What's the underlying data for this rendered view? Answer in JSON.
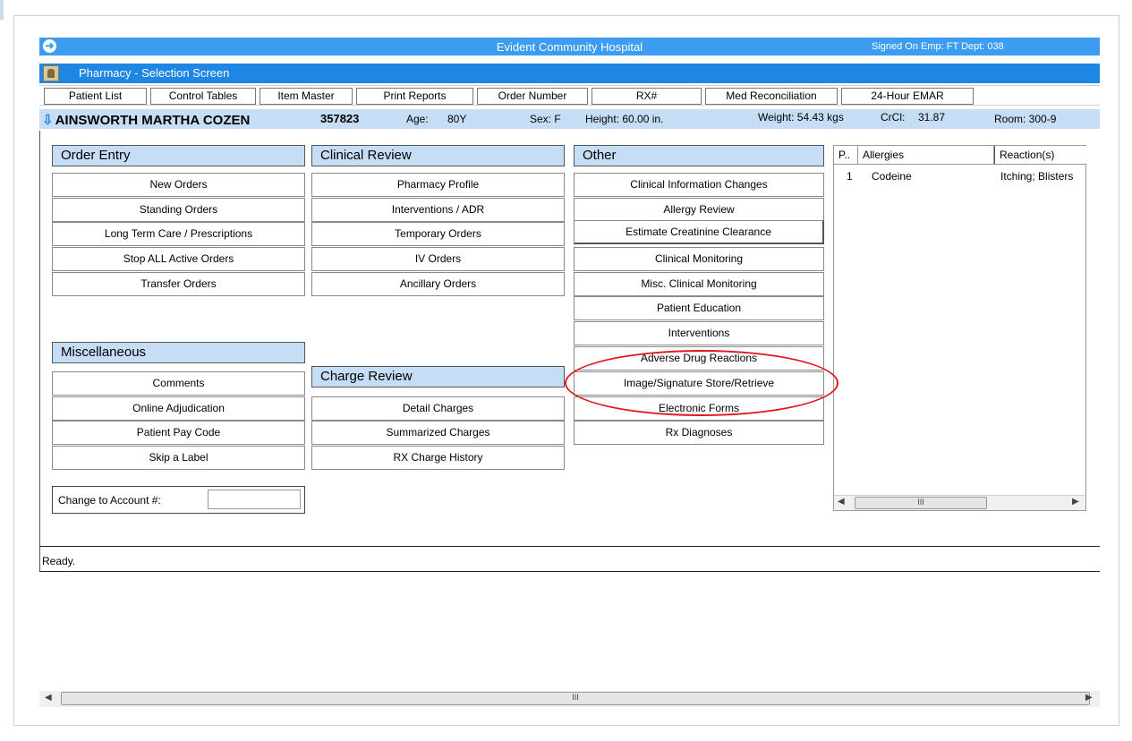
{
  "window": {
    "hospital_title": "Evident Community Hospital",
    "signed_on": "Signed On Emp: FT  Dept: 038",
    "screen_title": "Pharmacy - Selection Screen"
  },
  "toolbar": {
    "patient_list": "Patient List",
    "control_tables": "Control Tables",
    "item_master": "Item Master",
    "print_reports": "Print Reports",
    "order_number": "Order Number",
    "rx_number": "RX#",
    "med_reconciliation": "Med Reconciliation",
    "emar_24": "24-Hour EMAR"
  },
  "patient": {
    "name": "AINSWORTH MARTHA COZEN",
    "id": "357823",
    "age_label": "Age:",
    "age": "80Y",
    "sex": "Sex: F",
    "height": "Height: 60.00 in.",
    "weight": "Weight: 54.43 kgs",
    "crcl_label": "CrCl:",
    "crcl": "31.87",
    "room": "Room: 300-9"
  },
  "order_entry": {
    "header": "Order Entry",
    "new_orders": "New Orders",
    "standing_orders": "Standing Orders",
    "long_term_care": "Long Term Care / Prescriptions",
    "stop_all": "Stop ALL Active Orders",
    "transfer_orders": "Transfer Orders"
  },
  "clinical_review": {
    "header": "Clinical Review",
    "pharmacy_profile": "Pharmacy Profile",
    "interventions_adr": "Interventions / ADR",
    "temporary_orders": "Temporary Orders",
    "iv_orders": "IV Orders",
    "ancillary_orders": "Ancillary Orders"
  },
  "other": {
    "header": "Other",
    "clinical_info_changes": "Clinical Information Changes",
    "allergy_review": "Allergy Review",
    "estimate_crcl": "Estimate Creatinine Clearance",
    "clinical_monitoring": "Clinical Monitoring",
    "misc_clinical_monitoring": "Misc. Clinical Monitoring",
    "patient_education": "Patient Education",
    "interventions": "Interventions",
    "adverse_drug_reactions": "Adverse Drug Reactions",
    "image_signature": "Image/Signature Store/Retrieve",
    "electronic_forms": "Electronic Forms",
    "rx_diagnoses": "Rx Diagnoses"
  },
  "miscellaneous": {
    "header": "Miscellaneous",
    "comments": "Comments",
    "online_adjudication": "Online Adjudication",
    "patient_pay_code": "Patient Pay Code",
    "skip_label": "Skip a Label"
  },
  "charge_review": {
    "header": "Charge Review",
    "detail_charges": "Detail Charges",
    "summarized_charges": "Summarized Charges",
    "rx_charge_history": "RX Charge History"
  },
  "account": {
    "label": "Change to Account #:",
    "value": ""
  },
  "allergies": {
    "columns": {
      "p": "P..",
      "allergy": "Allergies",
      "reaction": "Reaction(s)"
    },
    "rows": [
      {
        "p": "1",
        "allergy": "Codeine",
        "reaction": "Itching; Blisters"
      }
    ]
  },
  "status": {
    "text": "Ready."
  },
  "icons": {
    "back": "back-arrow-icon",
    "app": "pharmacist-icon",
    "patient_arrow": "down-arrow-icon",
    "scroll_thumb_grip": "III"
  },
  "colors": {
    "title_blue": "#3c9cf0",
    "subbar_blue": "#1e86e3",
    "header_light_blue": "#c5def6",
    "highlight_red": "#e0181e"
  }
}
